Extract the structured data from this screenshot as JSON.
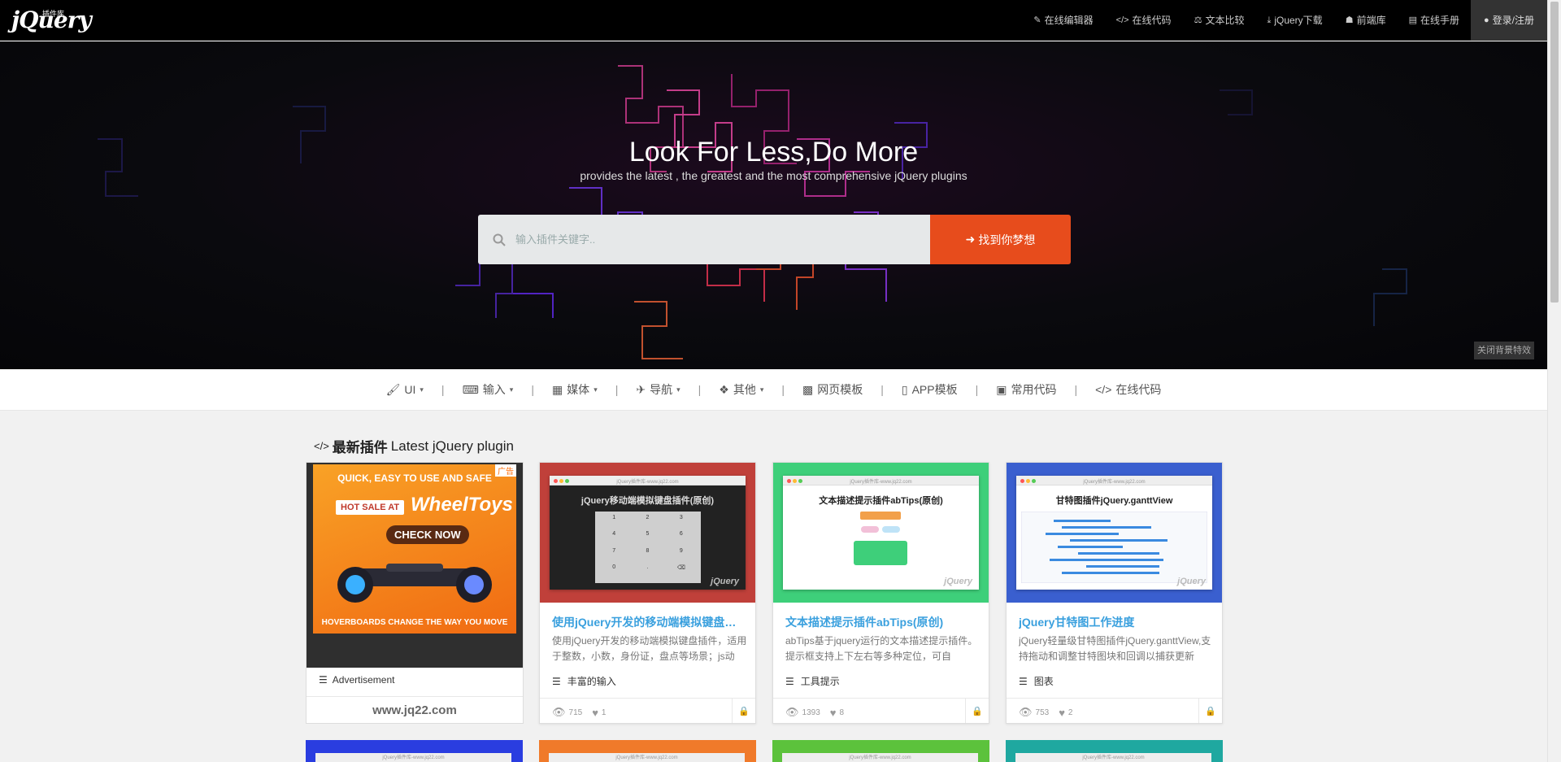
{
  "brand": {
    "logo_text": "jQuery",
    "logo_cn": "插件库"
  },
  "topnav": [
    {
      "icon": "edit-icon",
      "label": "在线编辑器"
    },
    {
      "icon": "code-icon",
      "label": "在线代码"
    },
    {
      "icon": "scale-icon",
      "label": "文本比较"
    },
    {
      "icon": "download-icon",
      "label": "jQuery下载"
    },
    {
      "icon": "user-secret-icon",
      "label": "前端库"
    },
    {
      "icon": "book-icon",
      "label": "在线手册"
    },
    {
      "icon": "user-icon",
      "label": "登录/注册"
    }
  ],
  "hero": {
    "title": "Look For Less,Do More",
    "subtitle": "provides the latest , the greatest and the most comprehensive jQuery plugins",
    "search_placeholder": "输入插件关键字..",
    "search_button": "找到你梦想",
    "close_fx": "关闭背景特效"
  },
  "categories": [
    {
      "icon": "brush-icon",
      "label": "UI",
      "dropdown": true
    },
    {
      "icon": "keyboard-icon",
      "label": "输入",
      "dropdown": true
    },
    {
      "icon": "film-icon",
      "label": "媒体",
      "dropdown": true
    },
    {
      "icon": "send-icon",
      "label": "导航",
      "dropdown": true
    },
    {
      "icon": "dropbox-icon",
      "label": "其他",
      "dropdown": true
    },
    {
      "icon": "grid-icon",
      "label": "网页模板",
      "dropdown": false
    },
    {
      "icon": "mobile-icon",
      "label": "APP模板",
      "dropdown": false
    },
    {
      "icon": "file-code-icon",
      "label": "常用代码",
      "dropdown": false
    },
    {
      "icon": "code-icon",
      "label": "在线代码",
      "dropdown": false
    }
  ],
  "section": {
    "title_cn": "最新插件",
    "title_en": "Latest jQuery plugin"
  },
  "ad": {
    "tag": "广告",
    "line1": "QUICK, EASY TO USE AND SAFE",
    "line2": "HOT SALE AT",
    "line3": "WheelToys",
    "line4": "CHECK NOW",
    "line5": "HOVERBOARDS CHANGE THE WAY YOU MOVE",
    "label": "Advertisement",
    "site": "www.jq22.com"
  },
  "cards": [
    {
      "thumb_color": "#c0403a",
      "thumb_title": "jQuery移动端模拟键盘插件(原创)",
      "thumb_url": "jQuery插件库-www.jq22.com",
      "title": "使用jQuery开发的移动端模拟键盘插件(原创)",
      "desc": "使用jQuery开发的移动端模拟键盘插件，适用于整数，小数，身份证，盘点等场景；js动",
      "category": "丰富的输入",
      "views": "715",
      "likes": "1"
    },
    {
      "thumb_color": "#3ecf7a",
      "thumb_title": "文本描述提示插件abTips(原创)",
      "thumb_url": "jQuery插件库-www.jq22.com",
      "title": "文本描述提示插件abTips(原创)",
      "desc": "abTips基于jquery运行的文本描述提示插件。提示框支持上下左右等多种定位，可自",
      "category": "工具提示",
      "views": "1393",
      "likes": "8"
    },
    {
      "thumb_color": "#3a5fcf",
      "thumb_title": "甘特图插件jQuery.ganttView",
      "thumb_url": "jQuery插件库-www.jq22.com",
      "title": "jQuery甘特图工作进度",
      "desc": "jQuery轻量级甘特图插件jQuery.ganttView,支持拖动和调整甘特图块和回调以捕获更新",
      "category": "图表",
      "views": "753",
      "likes": "2"
    }
  ],
  "row2_colors": [
    "#2a3de0",
    "#f07a2a",
    "#5cc23c",
    "#1fa8a0"
  ],
  "row2_url": "jQuery插件库-www.jq22.com",
  "logo_watermark": "jQuery"
}
